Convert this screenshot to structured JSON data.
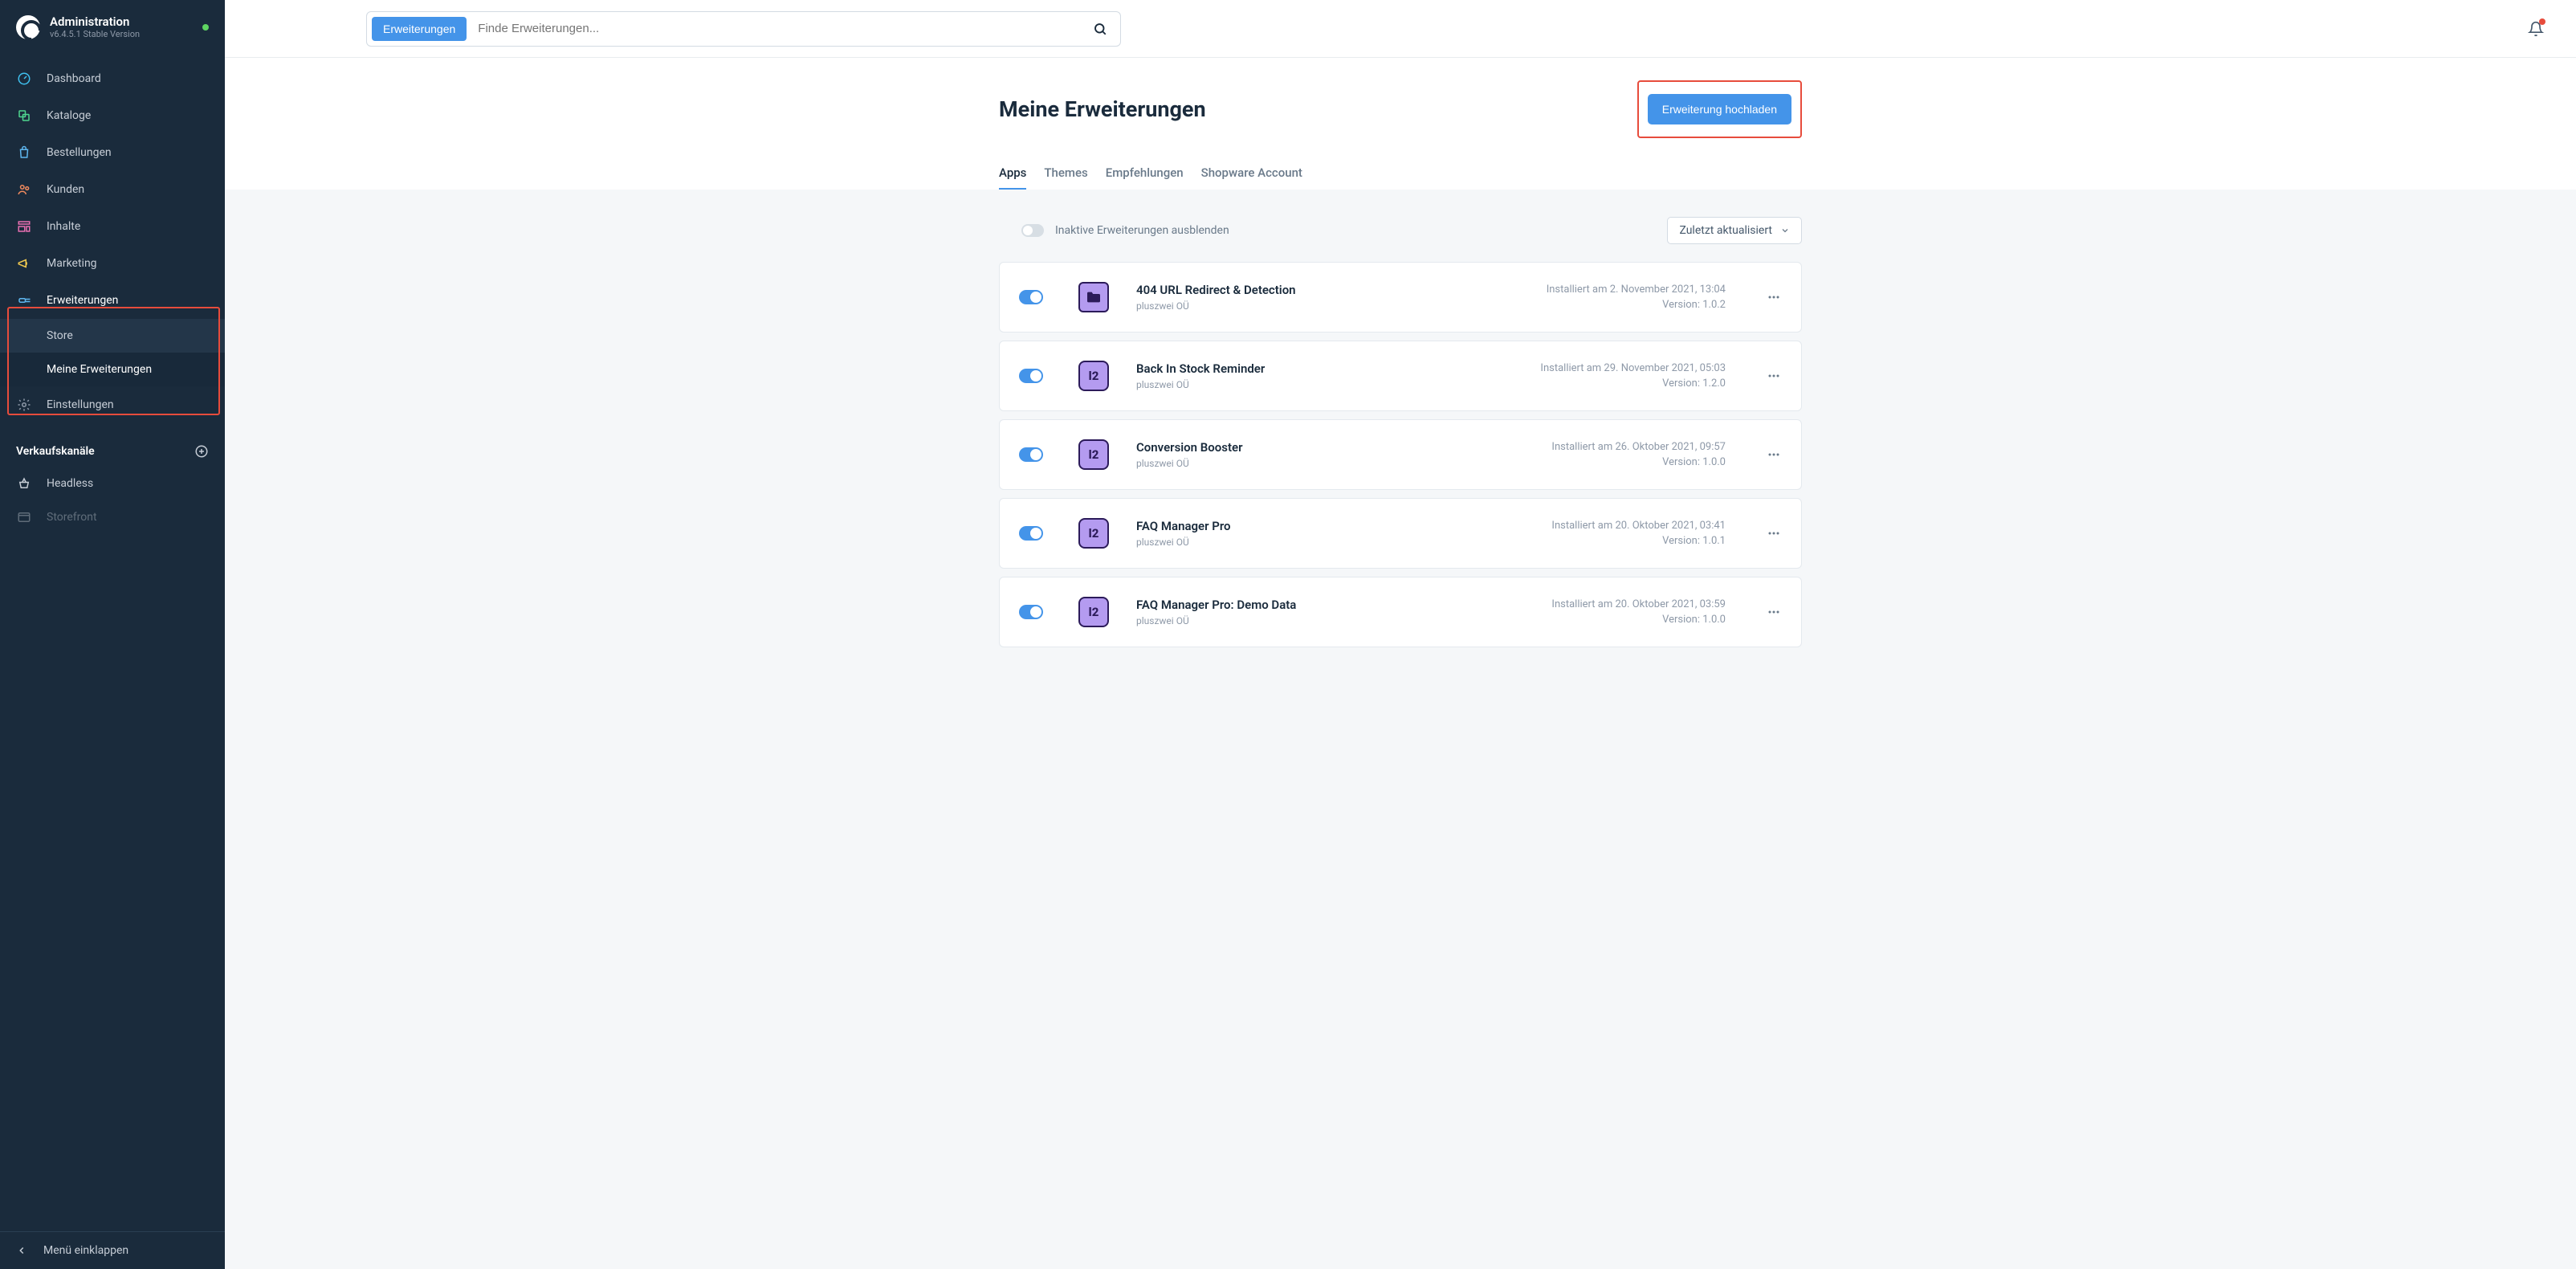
{
  "brand": {
    "title": "Administration",
    "subtitle": "v6.4.5.1 Stable Version"
  },
  "nav": [
    {
      "label": "Dashboard",
      "icon": "gauge",
      "color": "#3fc0ef"
    },
    {
      "label": "Kataloge",
      "icon": "copy",
      "color": "#4fd68f"
    },
    {
      "label": "Bestellungen",
      "icon": "bag",
      "color": "#5eb7f0"
    },
    {
      "label": "Kunden",
      "icon": "users",
      "color": "#f08a5e"
    },
    {
      "label": "Inhalte",
      "icon": "layout",
      "color": "#e86fb1"
    },
    {
      "label": "Marketing",
      "icon": "megaphone",
      "color": "#f0c94f"
    },
    {
      "label": "Erweiterungen",
      "icon": "plug",
      "color": "#5eb7f0",
      "expanded": true,
      "sub": [
        {
          "label": "Store"
        },
        {
          "label": "Meine Erweiterungen",
          "active": true
        }
      ]
    },
    {
      "label": "Einstellungen",
      "icon": "gear",
      "color": "#8e99a8"
    }
  ],
  "channelsLabel": "Verkaufskanäle",
  "channels": [
    {
      "label": "Headless",
      "icon": "basket"
    },
    {
      "label": "Storefront",
      "icon": "browser",
      "faded": true
    }
  ],
  "collapseLabel": "Menü einklappen",
  "search": {
    "btn": "Erweiterungen",
    "placeholder": "Finde Erweiterungen..."
  },
  "page": {
    "title": "Meine Erweiterungen",
    "uploadBtn": "Erweiterung hochladen"
  },
  "tabs": [
    {
      "label": "Apps",
      "active": true
    },
    {
      "label": "Themes"
    },
    {
      "label": "Empfehlungen"
    },
    {
      "label": "Shopware Account"
    }
  ],
  "hideInactiveLabel": "Inaktive Erweiterungen ausblenden",
  "sortLabel": "Zuletzt aktualisiert",
  "items": [
    {
      "title": "404 URL Redirect & Detection",
      "vendor": "pluszwei OÜ",
      "installed": "Installiert am 2. November 2021, 13:04",
      "version": "Version: 1.0.2",
      "icon": "folder"
    },
    {
      "title": "Back In Stock Reminder",
      "vendor": "pluszwei OÜ",
      "installed": "Installiert am 29. November 2021, 05:03",
      "version": "Version: 1.2.0",
      "icon": "p2"
    },
    {
      "title": "Conversion Booster",
      "vendor": "pluszwei OÜ",
      "installed": "Installiert am 26. Oktober 2021, 09:57",
      "version": "Version: 1.0.0",
      "icon": "p2"
    },
    {
      "title": "FAQ Manager Pro",
      "vendor": "pluszwei OÜ",
      "installed": "Installiert am 20. Oktober 2021, 03:41",
      "version": "Version: 1.0.1",
      "icon": "p2"
    },
    {
      "title": "FAQ Manager Pro: Demo Data",
      "vendor": "pluszwei OÜ",
      "installed": "Installiert am 20. Oktober 2021, 03:59",
      "version": "Version: 1.0.0",
      "icon": "p2"
    }
  ]
}
